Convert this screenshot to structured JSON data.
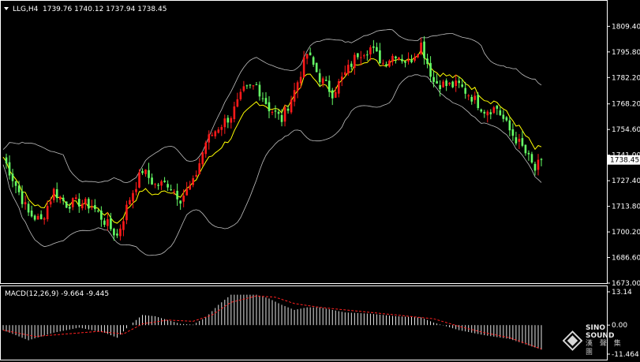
{
  "header": {
    "symbol_label": "LLG,H4",
    "ohlc_label": "1739.76 1740.12 1737.94 1738.45"
  },
  "macd_header": {
    "label": "MACD(12,26,9) -9.664 -9.445"
  },
  "logo": {
    "line1": "SINO SOUND",
    "line2": "漢 聲 集 團"
  },
  "colors": {
    "background": "#000000",
    "bull_candle": "#ff1a1a",
    "bear_candle": "#66ff66",
    "bollinger": "#c0c0c0",
    "moving_average": "#ffff00",
    "macd_histogram": "#ffffff",
    "macd_signal": "#ff2020",
    "current_price_box": "#ffffff"
  },
  "chart_data": [
    {
      "type": "candlestick",
      "symbol": "LLG",
      "timeframe": "H4",
      "y_ticks": [
        "1809.40",
        "1795.80",
        "1782.20",
        "1768.20",
        "1754.60",
        "1741.00",
        "1727.40",
        "1713.80",
        "1700.20",
        "1686.60",
        "1673.00"
      ],
      "ylim": [
        1673.0,
        1815.0
      ],
      "last_price_label": "1738.45",
      "last_price": 1738.45,
      "bollinger_period_overlay": true,
      "close_path": [
        {
          "bar": 0,
          "close": 1740
        },
        {
          "bar": 4,
          "close": 1725
        },
        {
          "bar": 8,
          "close": 1710
        },
        {
          "bar": 12,
          "close": 1706
        },
        {
          "bar": 16,
          "close": 1722
        },
        {
          "bar": 20,
          "close": 1715
        },
        {
          "bar": 24,
          "close": 1716
        },
        {
          "bar": 28,
          "close": 1714
        },
        {
          "bar": 32,
          "close": 1706
        },
        {
          "bar": 36,
          "close": 1698
        },
        {
          "bar": 40,
          "close": 1718
        },
        {
          "bar": 44,
          "close": 1733
        },
        {
          "bar": 48,
          "close": 1725
        },
        {
          "bar": 52,
          "close": 1726
        },
        {
          "bar": 56,
          "close": 1718
        },
        {
          "bar": 60,
          "close": 1726
        },
        {
          "bar": 64,
          "close": 1748
        },
        {
          "bar": 68,
          "close": 1756
        },
        {
          "bar": 72,
          "close": 1762
        },
        {
          "bar": 76,
          "close": 1775
        },
        {
          "bar": 80,
          "close": 1778
        },
        {
          "bar": 84,
          "close": 1766
        },
        {
          "bar": 88,
          "close": 1760
        },
        {
          "bar": 92,
          "close": 1775
        },
        {
          "bar": 96,
          "close": 1795
        },
        {
          "bar": 100,
          "close": 1782
        },
        {
          "bar": 104,
          "close": 1774
        },
        {
          "bar": 108,
          "close": 1784
        },
        {
          "bar": 112,
          "close": 1795
        },
        {
          "bar": 116,
          "close": 1798
        },
        {
          "bar": 120,
          "close": 1790
        },
        {
          "bar": 124,
          "close": 1795
        },
        {
          "bar": 128,
          "close": 1790
        },
        {
          "bar": 132,
          "close": 1800
        },
        {
          "bar": 136,
          "close": 1780
        },
        {
          "bar": 140,
          "close": 1778
        },
        {
          "bar": 144,
          "close": 1778
        },
        {
          "bar": 148,
          "close": 1772
        },
        {
          "bar": 152,
          "close": 1765
        },
        {
          "bar": 156,
          "close": 1766
        },
        {
          "bar": 160,
          "close": 1754
        },
        {
          "bar": 164,
          "close": 1745
        },
        {
          "bar": 168,
          "close": 1733
        },
        {
          "bar": 170,
          "close": 1738.45
        }
      ]
    },
    {
      "type": "bar",
      "indicator": "MACD",
      "params": "12,26,9",
      "main_value": -9.664,
      "signal_value": -9.445,
      "y_ticks": [
        "13.14",
        "0.00",
        "-11.464"
      ],
      "ylim": [
        -11.464,
        13.14
      ],
      "histogram_path": [
        {
          "bar": 0,
          "value": -2
        },
        {
          "bar": 8,
          "value": -6
        },
        {
          "bar": 16,
          "value": -3
        },
        {
          "bar": 24,
          "value": -1
        },
        {
          "bar": 32,
          "value": -3
        },
        {
          "bar": 36,
          "value": -5
        },
        {
          "bar": 40,
          "value": 0
        },
        {
          "bar": 44,
          "value": 4
        },
        {
          "bar": 48,
          "value": 3.5
        },
        {
          "bar": 52,
          "value": 2
        },
        {
          "bar": 56,
          "value": 0.5
        },
        {
          "bar": 60,
          "value": 0.2
        },
        {
          "bar": 64,
          "value": 3
        },
        {
          "bar": 68,
          "value": 8
        },
        {
          "bar": 72,
          "value": 12
        },
        {
          "bar": 80,
          "value": 12
        },
        {
          "bar": 84,
          "value": 10.5
        },
        {
          "bar": 88,
          "value": 8
        },
        {
          "bar": 92,
          "value": 6
        },
        {
          "bar": 96,
          "value": 7
        },
        {
          "bar": 100,
          "value": 7
        },
        {
          "bar": 108,
          "value": 5
        },
        {
          "bar": 116,
          "value": 4.5
        },
        {
          "bar": 124,
          "value": 3.5
        },
        {
          "bar": 132,
          "value": 3
        },
        {
          "bar": 136,
          "value": 1
        },
        {
          "bar": 144,
          "value": -2
        },
        {
          "bar": 152,
          "value": -4
        },
        {
          "bar": 160,
          "value": -5.5
        },
        {
          "bar": 170,
          "value": -9.664
        }
      ],
      "signal_path": [
        {
          "bar": 0,
          "value": -2
        },
        {
          "bar": 10,
          "value": -4.5
        },
        {
          "bar": 20,
          "value": -3.5
        },
        {
          "bar": 30,
          "value": -2.5
        },
        {
          "bar": 38,
          "value": -3.5
        },
        {
          "bar": 44,
          "value": 0.5
        },
        {
          "bar": 52,
          "value": 2
        },
        {
          "bar": 60,
          "value": 1.5
        },
        {
          "bar": 66,
          "value": 4
        },
        {
          "bar": 72,
          "value": 9
        },
        {
          "bar": 80,
          "value": 11.5
        },
        {
          "bar": 86,
          "value": 11
        },
        {
          "bar": 92,
          "value": 8.5
        },
        {
          "bar": 100,
          "value": 7
        },
        {
          "bar": 112,
          "value": 5.5
        },
        {
          "bar": 124,
          "value": 4
        },
        {
          "bar": 136,
          "value": 2.5
        },
        {
          "bar": 144,
          "value": -0.5
        },
        {
          "bar": 152,
          "value": -3
        },
        {
          "bar": 160,
          "value": -5
        },
        {
          "bar": 170,
          "value": -9.445
        }
      ]
    }
  ]
}
